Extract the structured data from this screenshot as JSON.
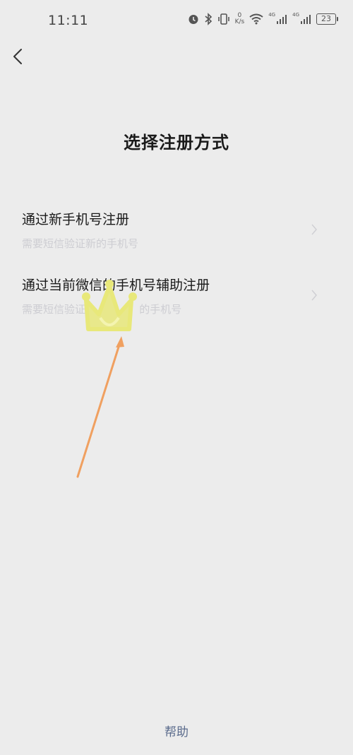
{
  "status_bar": {
    "time": "11:11",
    "net_speed_value": "0",
    "net_speed_unit": "K/s",
    "signal1_label": "4G",
    "signal2_label": "4G",
    "battery": "23"
  },
  "page": {
    "title": "选择注册方式"
  },
  "options": [
    {
      "title": "通过新手机号注册",
      "subtitle": "需要短信验证新的手机号"
    },
    {
      "title": "通过当前微信的手机号辅助注册",
      "subtitle": "需要短信验证                的手机号"
    }
  ],
  "footer": {
    "help": "帮助"
  },
  "icons": {
    "back": "chevron-left-icon",
    "option_arrow": "chevron-right-icon",
    "crown_sticker": "crown-icon",
    "pointer_arrow": "arrow-icon"
  },
  "colors": {
    "background": "#ececec",
    "link": "#5a6b8c",
    "crown": "#e8e87a",
    "arrow": "#f0a060"
  }
}
